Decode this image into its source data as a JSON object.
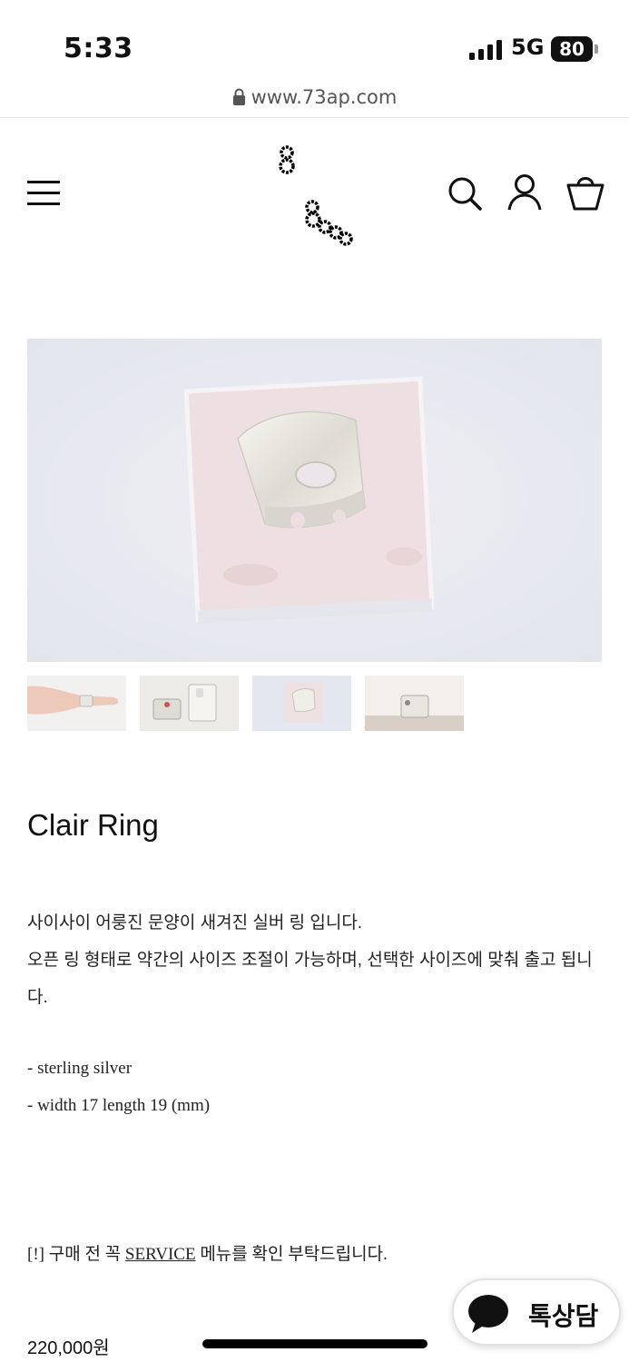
{
  "status_bar": {
    "time": "5:33",
    "network": "5G",
    "battery": "80"
  },
  "browser": {
    "url": "www.73ap.com"
  },
  "header": {
    "menu_icon": "hamburger-menu-icon",
    "logo_icon": "chain-logo-icon",
    "search_icon": "search-icon",
    "account_icon": "account-icon",
    "bag_icon": "shopping-bag-icon"
  },
  "gallery": {
    "thumbnail_count": 4
  },
  "product": {
    "title": "Clair Ring",
    "description_line_1": "사이사이 어룽진 문양이 새겨진 실버 링 입니다.",
    "description_line_2": "오픈 링 형태로 약간의 사이즈 조절이 가능하며, 선택한 사이즈에 맞춰 출고 됩니",
    "description_line_3": "다.",
    "spec_material": "- sterling silver",
    "spec_size": "- width 17 length 19 (mm)",
    "notice_prefix": "[!] 구매 전 꼭 ",
    "notice_link": "SERVICE",
    "notice_suffix": " 메뉴를 확인 부탁드립니다.",
    "price": "220,000원"
  },
  "chat": {
    "label": "톡상담",
    "icon": "speech-bubble-icon"
  },
  "colors": {
    "text": "#111111",
    "background": "#ffffff",
    "image_bg": "#e9ebf2"
  }
}
